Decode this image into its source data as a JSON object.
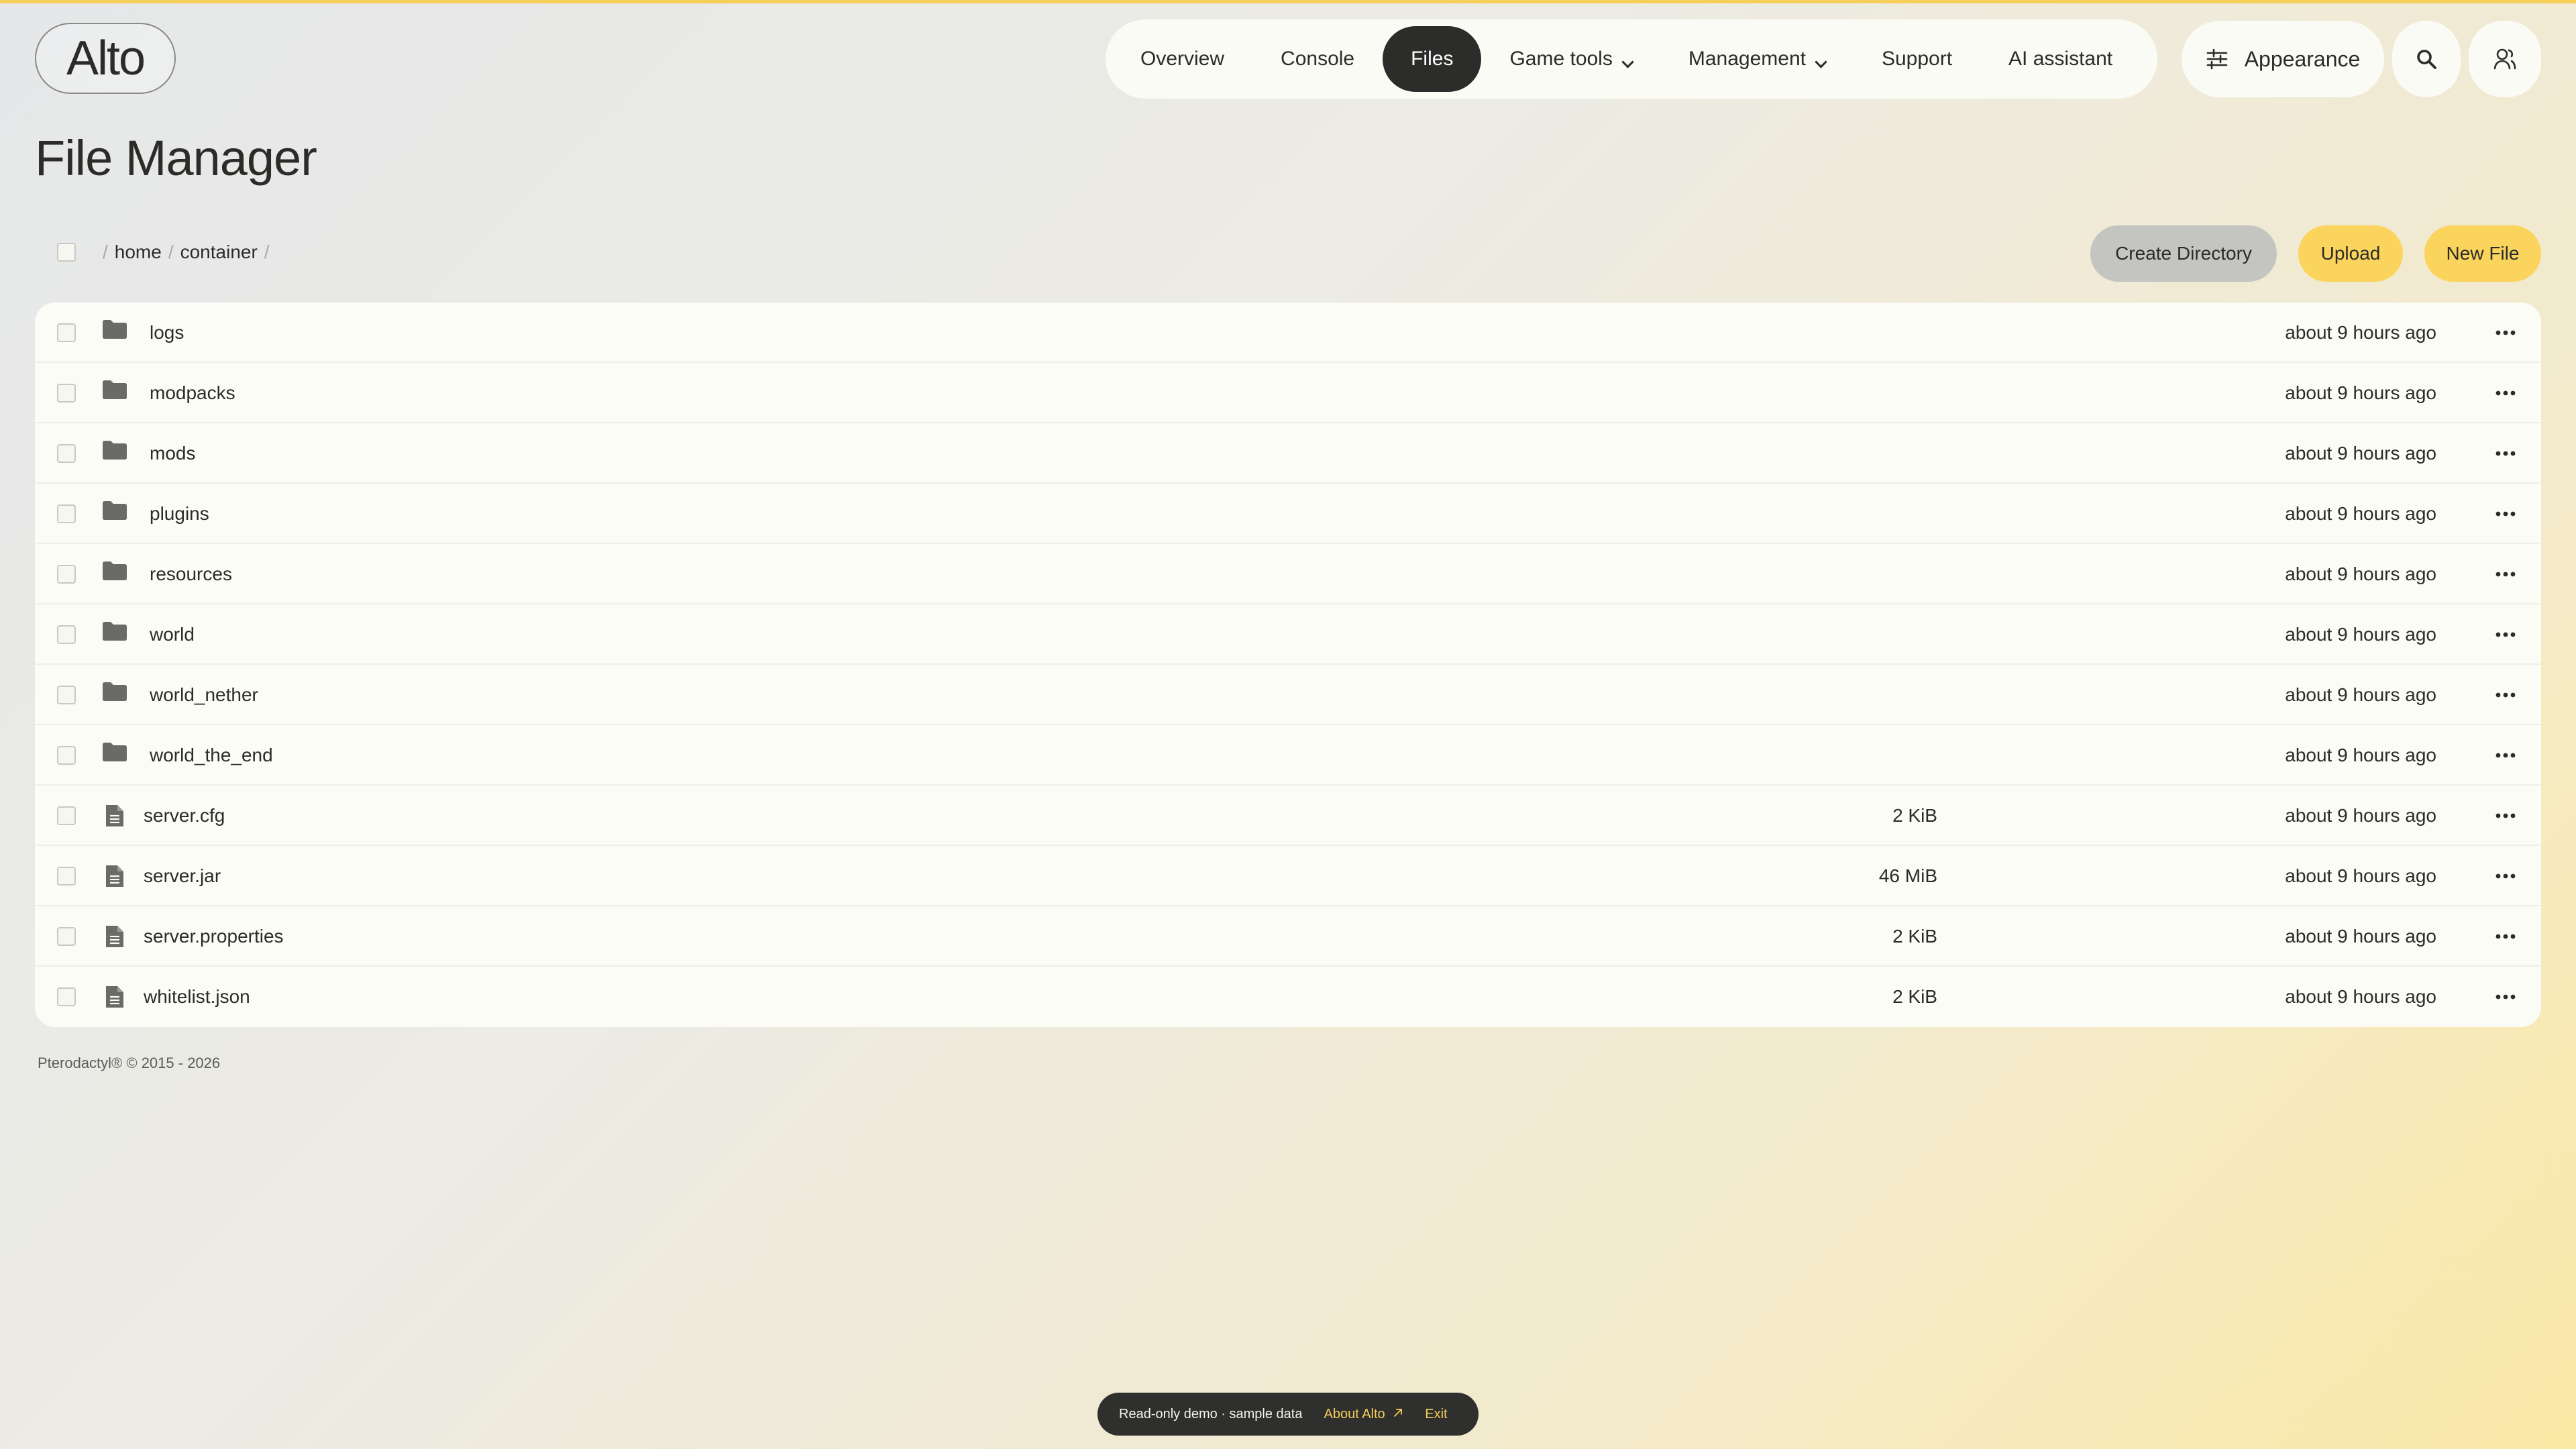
{
  "brand": {
    "logo_text": "Alto",
    "accent_color": "#f5cf5a",
    "dark_color": "#2c2d2a"
  },
  "nav": {
    "items": [
      {
        "label": "Overview",
        "active": false,
        "has_dropdown": false
      },
      {
        "label": "Console",
        "active": false,
        "has_dropdown": false
      },
      {
        "label": "Files",
        "active": true,
        "has_dropdown": false
      },
      {
        "label": "Game tools",
        "active": false,
        "has_dropdown": true
      },
      {
        "label": "Management",
        "active": false,
        "has_dropdown": true
      },
      {
        "label": "Support",
        "active": false,
        "has_dropdown": false
      },
      {
        "label": "AI assistant",
        "active": false,
        "has_dropdown": false
      }
    ],
    "appearance_label": "Appearance",
    "appearance_icon": "sliders-icon",
    "search_icon": "search-icon",
    "account_icon": "user-icon"
  },
  "page": {
    "title": "File Manager"
  },
  "breadcrumb": {
    "separator": "/",
    "segments": [
      "home",
      "container"
    ]
  },
  "actions": {
    "create_directory": "Create Directory",
    "upload": "Upload",
    "new_file": "New File"
  },
  "files": [
    {
      "name": "logs",
      "type": "folder",
      "size": "",
      "modified": "about 9 hours ago"
    },
    {
      "name": "modpacks",
      "type": "folder",
      "size": "",
      "modified": "about 9 hours ago"
    },
    {
      "name": "mods",
      "type": "folder",
      "size": "",
      "modified": "about 9 hours ago"
    },
    {
      "name": "plugins",
      "type": "folder",
      "size": "",
      "modified": "about 9 hours ago"
    },
    {
      "name": "resources",
      "type": "folder",
      "size": "",
      "modified": "about 9 hours ago"
    },
    {
      "name": "world",
      "type": "folder",
      "size": "",
      "modified": "about 9 hours ago"
    },
    {
      "name": "world_nether",
      "type": "folder",
      "size": "",
      "modified": "about 9 hours ago"
    },
    {
      "name": "world_the_end",
      "type": "folder",
      "size": "",
      "modified": "about 9 hours ago"
    },
    {
      "name": "server.cfg",
      "type": "file",
      "size": "2 KiB",
      "modified": "about 9 hours ago"
    },
    {
      "name": "server.jar",
      "type": "file",
      "size": "46 MiB",
      "modified": "about 9 hours ago"
    },
    {
      "name": "server.properties",
      "type": "file",
      "size": "2 KiB",
      "modified": "about 9 hours ago"
    },
    {
      "name": "whitelist.json",
      "type": "file",
      "size": "2 KiB",
      "modified": "about 9 hours ago"
    }
  ],
  "footer": {
    "text": "Pterodactyl® © 2015 - 2026"
  },
  "demo_banner": {
    "text": "Read-only demo · sample data",
    "about_label": "About Alto",
    "exit_label": "Exit"
  }
}
